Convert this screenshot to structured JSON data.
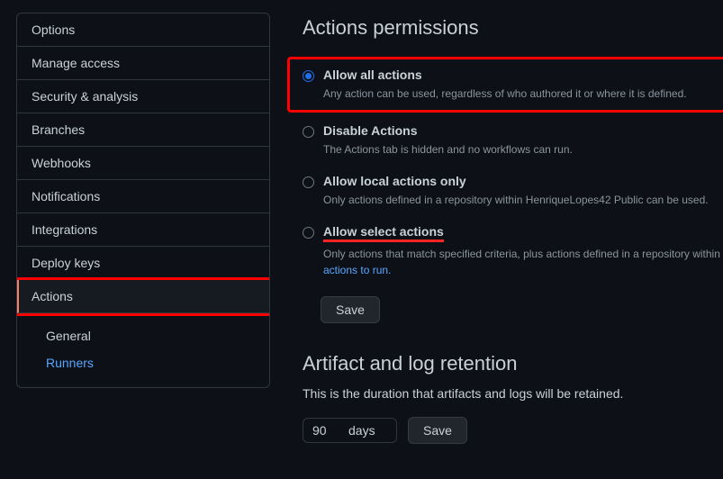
{
  "sidebar": {
    "items": [
      {
        "label": "Options"
      },
      {
        "label": "Manage access"
      },
      {
        "label": "Security & analysis"
      },
      {
        "label": "Branches"
      },
      {
        "label": "Webhooks"
      },
      {
        "label": "Notifications"
      },
      {
        "label": "Integrations"
      },
      {
        "label": "Deploy keys"
      },
      {
        "label": "Actions"
      }
    ],
    "subitems": [
      {
        "label": "General"
      },
      {
        "label": "Runners"
      }
    ]
  },
  "permissions": {
    "heading": "Actions permissions",
    "options": [
      {
        "title": "Allow all actions",
        "desc": "Any action can be used, regardless of who authored it or where it is defined."
      },
      {
        "title": "Disable Actions",
        "desc": "The Actions tab is hidden and no workflows can run."
      },
      {
        "title": "Allow local actions only",
        "desc": "Only actions defined in a repository within HenriqueLopes42 Public can be used."
      },
      {
        "title": "Allow select actions",
        "desc_a": "Only actions that match specified criteria, plus actions defined in a repository within ",
        "desc_link": "actions to run."
      }
    ],
    "save": "Save"
  },
  "retention": {
    "heading": "Artifact and log retention",
    "desc": "This is the duration that artifacts and logs will be retained.",
    "value": "90",
    "suffix": "days",
    "save": "Save"
  }
}
